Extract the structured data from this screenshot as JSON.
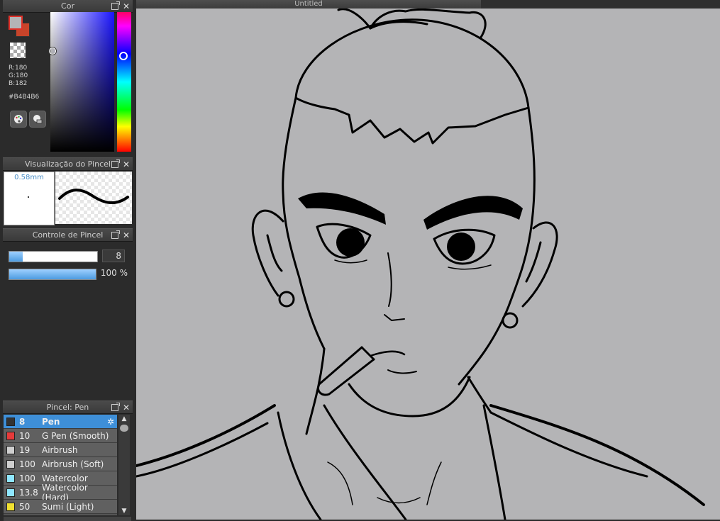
{
  "color_panel": {
    "title": "Cor",
    "r_text": "R:180",
    "g_text": "G:180",
    "b_text": "B:182",
    "hex": "#B4B4B6",
    "foreground_color": "#B4B4B6",
    "background_color": "#C8442A",
    "buttons": [
      "palette-icon",
      "color-mixer-icon"
    ]
  },
  "brush_preview": {
    "title": "Visualização do Pincel",
    "size_label": "0.58mm"
  },
  "brush_control": {
    "title": "Controle de Pincel",
    "size_value": "8",
    "size_fraction": 0.15,
    "opacity_label": "100 %",
    "opacity_fraction": 1.0
  },
  "brush_list": {
    "title": "Pincel: Pen",
    "items": [
      {
        "size": "8",
        "name": "Pen",
        "color": "#333333",
        "active": true
      },
      {
        "size": "10",
        "name": "G Pen (Smooth)",
        "color": "#e63a3a",
        "active": false
      },
      {
        "size": "19",
        "name": "Airbrush",
        "color": "#cfcfcf",
        "active": false
      },
      {
        "size": "100",
        "name": "Airbrush (Soft)",
        "color": "#cfcfcf",
        "active": false
      },
      {
        "size": "100",
        "name": "Watercolor",
        "color": "#8fe6ff",
        "active": false
      },
      {
        "size": "13.8",
        "name": "Watercolor (Hard)",
        "color": "#8fe6ff",
        "active": false
      },
      {
        "size": "50",
        "name": "Sumi (Light)",
        "color": "#f0e030",
        "active": false
      }
    ]
  },
  "canvas": {
    "title": "Untitled",
    "background": "#B4B4B6"
  }
}
